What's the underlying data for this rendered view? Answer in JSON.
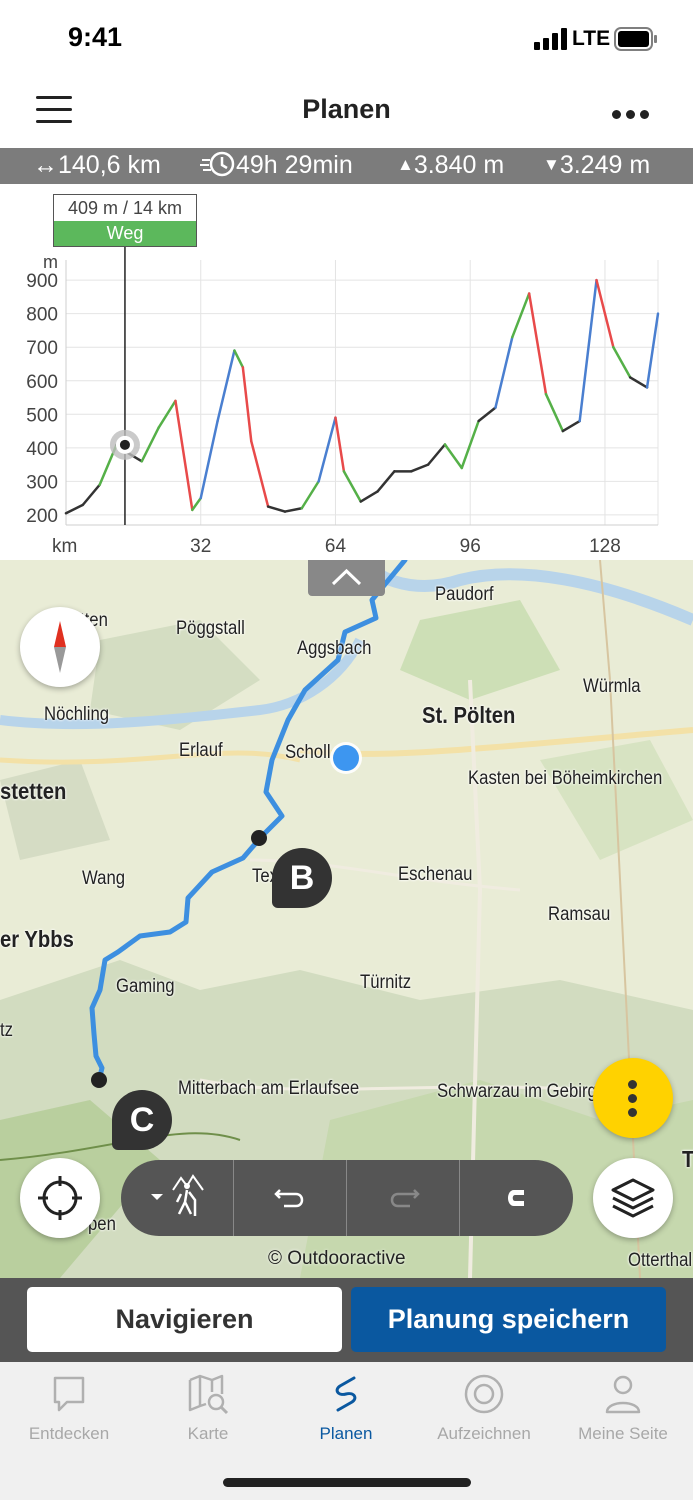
{
  "status_bar": {
    "time": "9:41",
    "network": "LTE"
  },
  "header": {
    "title": "Planen"
  },
  "stats": {
    "distance": "140,6 km",
    "duration": "49h 29min",
    "ascent": "3.840 m",
    "descent": "3.249 m"
  },
  "profile": {
    "tooltip_value": "409 m / 14 km",
    "tooltip_surface": "Weg",
    "y_unit": "m",
    "x_unit": "km",
    "chart_data": {
      "type": "line",
      "x": [
        0,
        4,
        8,
        12,
        14,
        18,
        22,
        26,
        30,
        32,
        36,
        40,
        42,
        44,
        48,
        52,
        56,
        60,
        64,
        66,
        70,
        74,
        78,
        82,
        86,
        90,
        94,
        98,
        102,
        106,
        110,
        114,
        118,
        122,
        126,
        130,
        134,
        138,
        140.6
      ],
      "y": [
        205,
        230,
        290,
        409,
        390,
        360,
        460,
        540,
        215,
        250,
        480,
        690,
        640,
        420,
        225,
        210,
        220,
        300,
        490,
        330,
        240,
        270,
        330,
        330,
        350,
        410,
        340,
        480,
        520,
        730,
        860,
        560,
        450,
        480,
        900,
        700,
        610,
        580,
        800
      ],
      "y_ticks": [
        200,
        300,
        400,
        500,
        600,
        700,
        800,
        900
      ],
      "x_ticks": [
        32,
        64,
        96,
        128
      ],
      "ylim": [
        170,
        960
      ],
      "xlim": [
        0,
        140.6
      ],
      "grid": true
    }
  },
  "map": {
    "places": [
      {
        "name": "Paudorf",
        "big": false
      },
      {
        "name": "tten",
        "big": false
      },
      {
        "name": "Pöggstall",
        "big": false
      },
      {
        "name": "Aggsbach",
        "big": false
      },
      {
        "name": "Würmla",
        "big": false
      },
      {
        "name": "Nöchling",
        "big": false
      },
      {
        "name": "St. Pölten",
        "big": true
      },
      {
        "name": "Erlauf",
        "big": false
      },
      {
        "name": "Scholl",
        "big": false
      },
      {
        "name": "Kasten bei Böheimkirchen",
        "big": false
      },
      {
        "name": "stetten",
        "big": true
      },
      {
        "name": "Wang",
        "big": false
      },
      {
        "name": "Tex",
        "big": false
      },
      {
        "name": "Eschenau",
        "big": false
      },
      {
        "name": "Ramsau",
        "big": false
      },
      {
        "name": "er Ybbs",
        "big": true
      },
      {
        "name": "Gaming",
        "big": false
      },
      {
        "name": "Türnitz",
        "big": false
      },
      {
        "name": "tz",
        "big": false
      },
      {
        "name": "Mitterbach am Erlaufsee",
        "big": false
      },
      {
        "name": "Schwarzau im Gebirge",
        "big": false
      },
      {
        "name": "T",
        "big": true
      },
      {
        "name": "pen",
        "big": false
      },
      {
        "name": "Otterthal",
        "big": false
      }
    ],
    "marker_b": "B",
    "marker_c": "C",
    "copyright": "© Outdooractive"
  },
  "actions": {
    "navigate": "Navigieren",
    "save": "Planung speichern"
  },
  "tabs": [
    {
      "label": "Entdecken",
      "icon": "chat-bubble-icon"
    },
    {
      "label": "Karte",
      "icon": "map-search-icon"
    },
    {
      "label": "Planen",
      "icon": "route-icon"
    },
    {
      "label": "Aufzeichnen",
      "icon": "record-icon"
    },
    {
      "label": "Meine Seite",
      "icon": "user-icon"
    }
  ],
  "colors": {
    "accent": "#0a58a0",
    "fab": "#ffd200",
    "route": "#3d8fe0",
    "surface_weg": "#5cb85c"
  }
}
